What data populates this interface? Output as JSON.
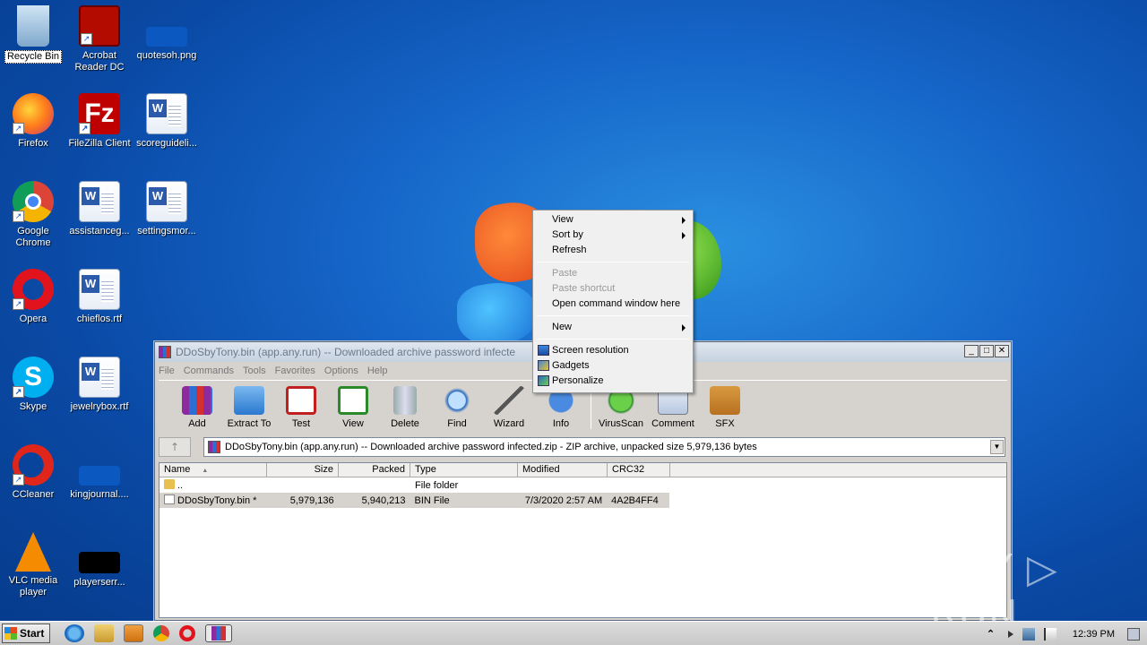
{
  "desktop": {
    "icons": [
      {
        "label": "Recycle Bin",
        "icon": "recycle-bin-icon"
      },
      {
        "label": "Acrobat Reader DC",
        "icon": "acrobat-icon"
      },
      {
        "label": "quotesoh.png",
        "icon": "image-file-icon"
      },
      {
        "label": "Firefox",
        "icon": "firefox-icon"
      },
      {
        "label": "FileZilla Client",
        "icon": "filezilla-icon"
      },
      {
        "label": "scoreguideli...",
        "icon": "word-doc-icon"
      },
      {
        "label": "Google Chrome",
        "icon": "chrome-icon"
      },
      {
        "label": "assistanceg...",
        "icon": "word-doc-icon"
      },
      {
        "label": "settingsmor...",
        "icon": "word-doc-icon"
      },
      {
        "label": "Opera",
        "icon": "opera-icon"
      },
      {
        "label": "chieflos.rtf",
        "icon": "word-doc-icon"
      },
      {
        "label": "Skype",
        "icon": "skype-icon"
      },
      {
        "label": "jewelrybox.rtf",
        "icon": "word-doc-icon"
      },
      {
        "label": "CCleaner",
        "icon": "ccleaner-icon"
      },
      {
        "label": "kingjournal....",
        "icon": "blank-file-icon"
      },
      {
        "label": "VLC media player",
        "icon": "vlc-icon"
      },
      {
        "label": "playerserr...",
        "icon": "black-file-icon"
      }
    ]
  },
  "rar": {
    "title": "DDoSbyTony.bin (app.any.run) -- Downloaded archive password infecte",
    "window_buttons": {
      "minimize": "_",
      "maximize": "□",
      "close": "✕"
    },
    "menu": [
      "File",
      "Commands",
      "Tools",
      "Favorites",
      "Options",
      "Help"
    ],
    "toolbar": [
      "Add",
      "Extract To",
      "Test",
      "View",
      "Delete",
      "Find",
      "Wizard",
      "Info",
      "VirusScan",
      "Comment",
      "SFX"
    ],
    "up_arrow": "↑",
    "address": "DDoSbyTony.bin (app.any.run) -- Downloaded archive password infected.zip - ZIP archive, unpacked size 5,979,136 bytes",
    "address_dropdown": "▼",
    "columns": {
      "name": "Name",
      "sort": "▲",
      "size": "Size",
      "packed": "Packed",
      "type": "Type",
      "modified": "Modified",
      "crc": "CRC32"
    },
    "rows": [
      {
        "name": "..",
        "size": "",
        "packed": "",
        "type": "File folder",
        "modified": "",
        "crc": ""
      },
      {
        "name": "DDoSbyTony.bin *",
        "size": "5,979,136",
        "packed": "5,940,213",
        "type": "BIN File",
        "modified": "7/3/2020 2:57 AM",
        "crc": "4A2B4FF4"
      }
    ]
  },
  "context_menu": {
    "view": "View",
    "sort_by": "Sort by",
    "refresh": "Refresh",
    "paste": "Paste",
    "paste_shortcut": "Paste shortcut",
    "open_cmd": "Open command window here",
    "new": "New",
    "screen_resolution": "Screen resolution",
    "gadgets": "Gadgets",
    "personalize": "Personalize"
  },
  "taskbar": {
    "start": "Start",
    "clock": "12:39 PM",
    "tray_arrow": "⌃"
  },
  "watermark": "ANY ▷ RUN"
}
